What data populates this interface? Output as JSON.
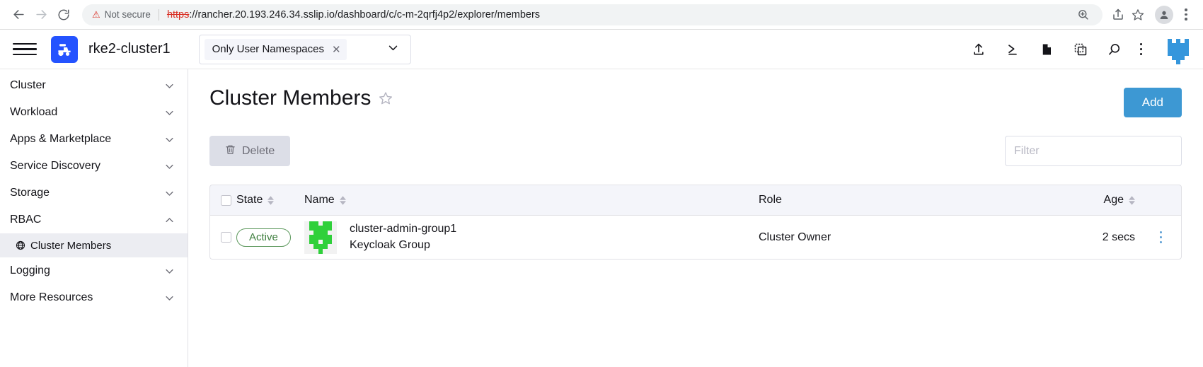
{
  "browser": {
    "back_icon": "arrow-left-icon",
    "forward_icon": "arrow-right-icon",
    "reload_icon": "reload-icon",
    "security_label": "Not secure",
    "url_scheme": "https",
    "url_rest": "://rancher.20.193.246.34.sslip.io/dashboard/c/c-m-2qrfj4p2/explorer/members",
    "zoom_icon": "zoom-in-icon",
    "share_icon": "share-icon",
    "bookmark_icon": "star-bookmark-icon",
    "profile_icon": "profile-avatar-icon",
    "menu_icon": "browser-menu-icon"
  },
  "app_header": {
    "menu_icon": "hamburger-menu-icon",
    "cluster_logo_icon": "rke2-cluster-logo-icon",
    "cluster_name": "rke2-cluster1",
    "namespace_filter": {
      "chip_label": "Only User Namespaces",
      "remove_icon": "close-icon",
      "caret_icon": "chevron-down-icon"
    },
    "tools": [
      {
        "name": "import-yaml-icon",
        "label": "Import YAML"
      },
      {
        "name": "kubectl-shell-icon",
        "label": "Kubectl Shell"
      },
      {
        "name": "docs-icon",
        "label": "Docs"
      },
      {
        "name": "cluster-copy-icon",
        "label": "Copy KubeConfig"
      },
      {
        "name": "search-icon",
        "label": "Search"
      }
    ],
    "kebab_icon": "header-menu-icon",
    "avatar_icon": "user-identicon-avatar",
    "avatar_color": "#3596dc"
  },
  "sidebar": {
    "groups": [
      {
        "label": "Cluster",
        "expanded": false
      },
      {
        "label": "Workload",
        "expanded": false
      },
      {
        "label": "Apps & Marketplace",
        "expanded": false
      },
      {
        "label": "Service Discovery",
        "expanded": false
      },
      {
        "label": "Storage",
        "expanded": false
      },
      {
        "label": "RBAC",
        "expanded": true
      }
    ],
    "rbac_children": [
      {
        "label": "Cluster Members",
        "icon": "globe-icon",
        "active": true
      }
    ],
    "groups_after": [
      {
        "label": "Logging",
        "expanded": false
      },
      {
        "label": "More Resources",
        "expanded": false
      }
    ]
  },
  "main": {
    "title": "Cluster Members",
    "favorite_icon": "star-outline-icon",
    "add_button": "Add",
    "accent_color": "#3d98d3",
    "toolbar": {
      "delete_label": "Delete",
      "delete_icon": "trash-icon",
      "filter_placeholder": "Filter",
      "filter_value": ""
    },
    "table": {
      "select_all_checkbox": "",
      "columns": [
        {
          "label": "State",
          "sortable": true
        },
        {
          "label": "Name",
          "sortable": true
        },
        {
          "label": "Role",
          "sortable": false
        },
        {
          "label": "Age",
          "sortable": true
        }
      ],
      "rows": [
        {
          "state": "Active",
          "state_color": "#3d7d3d",
          "name": "cluster-admin-group1",
          "subname": "Keycloak Group",
          "avatar_icon": "group-identicon",
          "avatar_color": "#2fd03a",
          "role": "Cluster Owner",
          "age": "2 secs",
          "actions_icon": "row-actions-menu-icon"
        }
      ]
    }
  }
}
